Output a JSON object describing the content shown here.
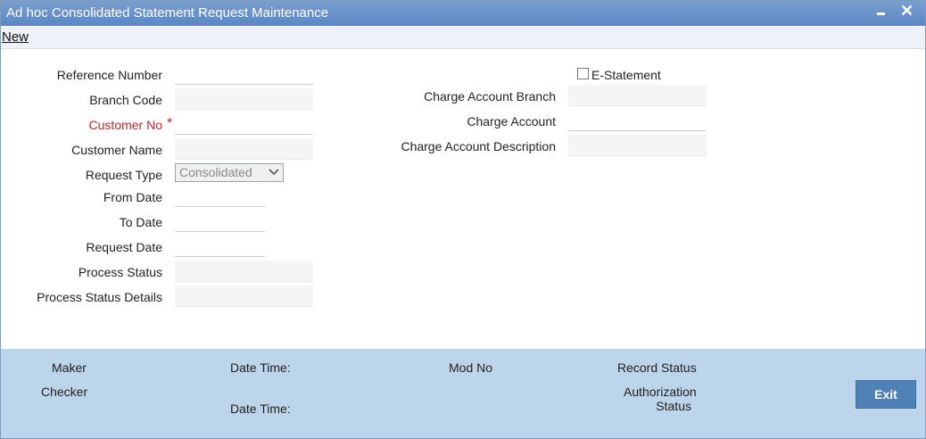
{
  "window": {
    "title": "Ad hoc Consolidated Statement Request Maintenance",
    "minimize_icon": "minimize-icon",
    "close_icon": "close-icon"
  },
  "menu": {
    "new": "New"
  },
  "form": {
    "reference_number": {
      "label": "Reference Number",
      "value": ""
    },
    "branch_code": {
      "label": "Branch Code",
      "value": ""
    },
    "customer_no": {
      "label": "Customer No",
      "required_mark": "*",
      "value": ""
    },
    "customer_name": {
      "label": "Customer Name",
      "value": ""
    },
    "request_type": {
      "label": "Request Type",
      "value": "Consolidated"
    },
    "from_date": {
      "label": "From Date",
      "value": ""
    },
    "to_date": {
      "label": "To Date",
      "value": ""
    },
    "request_date": {
      "label": "Request Date",
      "value": ""
    },
    "process_status": {
      "label": "Process Status",
      "value": ""
    },
    "process_status_details": {
      "label": "Process Status Details",
      "value": ""
    },
    "e_statement": {
      "label": "E-Statement",
      "checked": false
    },
    "charge_account_branch": {
      "label": "Charge Account Branch",
      "value": ""
    },
    "charge_account": {
      "label": "Charge Account",
      "value": ""
    },
    "charge_account_description": {
      "label": "Charge Account Description",
      "value": ""
    }
  },
  "footer": {
    "maker": "Maker",
    "checker": "Checker",
    "date_time_1": "Date Time:",
    "date_time_2": "Date Time:",
    "mod_no": "Mod No",
    "record_status": "Record Status",
    "authorization_line1": "Authorization",
    "authorization_line2": "Status",
    "exit": "Exit"
  },
  "colors": {
    "titlebar": "#5b86c3",
    "footer": "#bcd5ea",
    "exit_button": "#4f81b7",
    "required": "#c0262b"
  }
}
